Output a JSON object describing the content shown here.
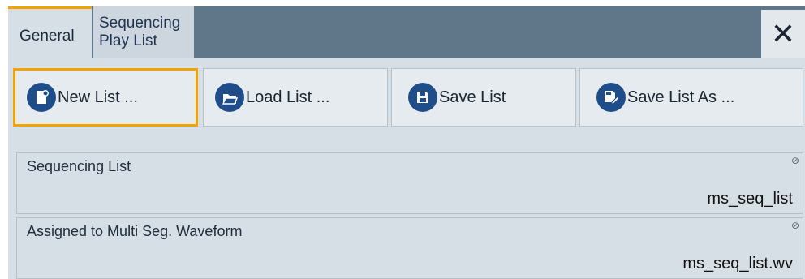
{
  "tabs": [
    {
      "label": "General"
    },
    {
      "label_line1": "Sequencing",
      "label_line2": "Play List"
    }
  ],
  "close_icon": "close-icon",
  "buttons": {
    "new_list": {
      "label": "New List ...",
      "icon": "new-document-icon"
    },
    "load_list": {
      "label": "Load List ...",
      "icon": "open-folder-icon"
    },
    "save_list": {
      "label": "Save List",
      "icon": "floppy-disk-icon"
    },
    "save_list_as": {
      "label": "Save List As ...",
      "icon": "floppy-disk-pen-icon"
    }
  },
  "fields": {
    "sequencing_list": {
      "label": "Sequencing List",
      "value": "ms_seq_list"
    },
    "assigned_waveform": {
      "label": "Assigned to Multi Seg. Waveform",
      "value": "ms_seq_list.wv"
    }
  },
  "colors": {
    "accent": "#f2a300",
    "header": "#5f7788",
    "icon": "#1f4d8a"
  }
}
